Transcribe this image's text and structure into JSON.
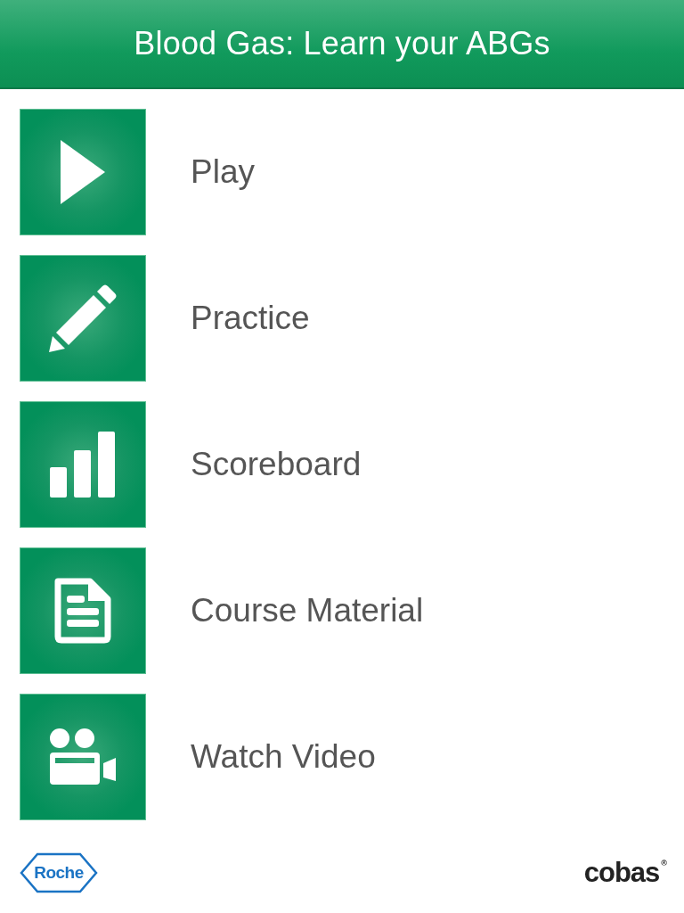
{
  "header": {
    "title": "Blood Gas: Learn your ABGs"
  },
  "menu": [
    {
      "kind": "play",
      "label": "Play"
    },
    {
      "kind": "pencil",
      "label": "Practice"
    },
    {
      "kind": "bars",
      "label": "Scoreboard"
    },
    {
      "kind": "document",
      "label": "Course Material"
    },
    {
      "kind": "camera",
      "label": "Watch Video"
    }
  ],
  "footer": {
    "left_logo": "Roche",
    "right_logo": "cobas",
    "right_logo_mark": "®"
  }
}
